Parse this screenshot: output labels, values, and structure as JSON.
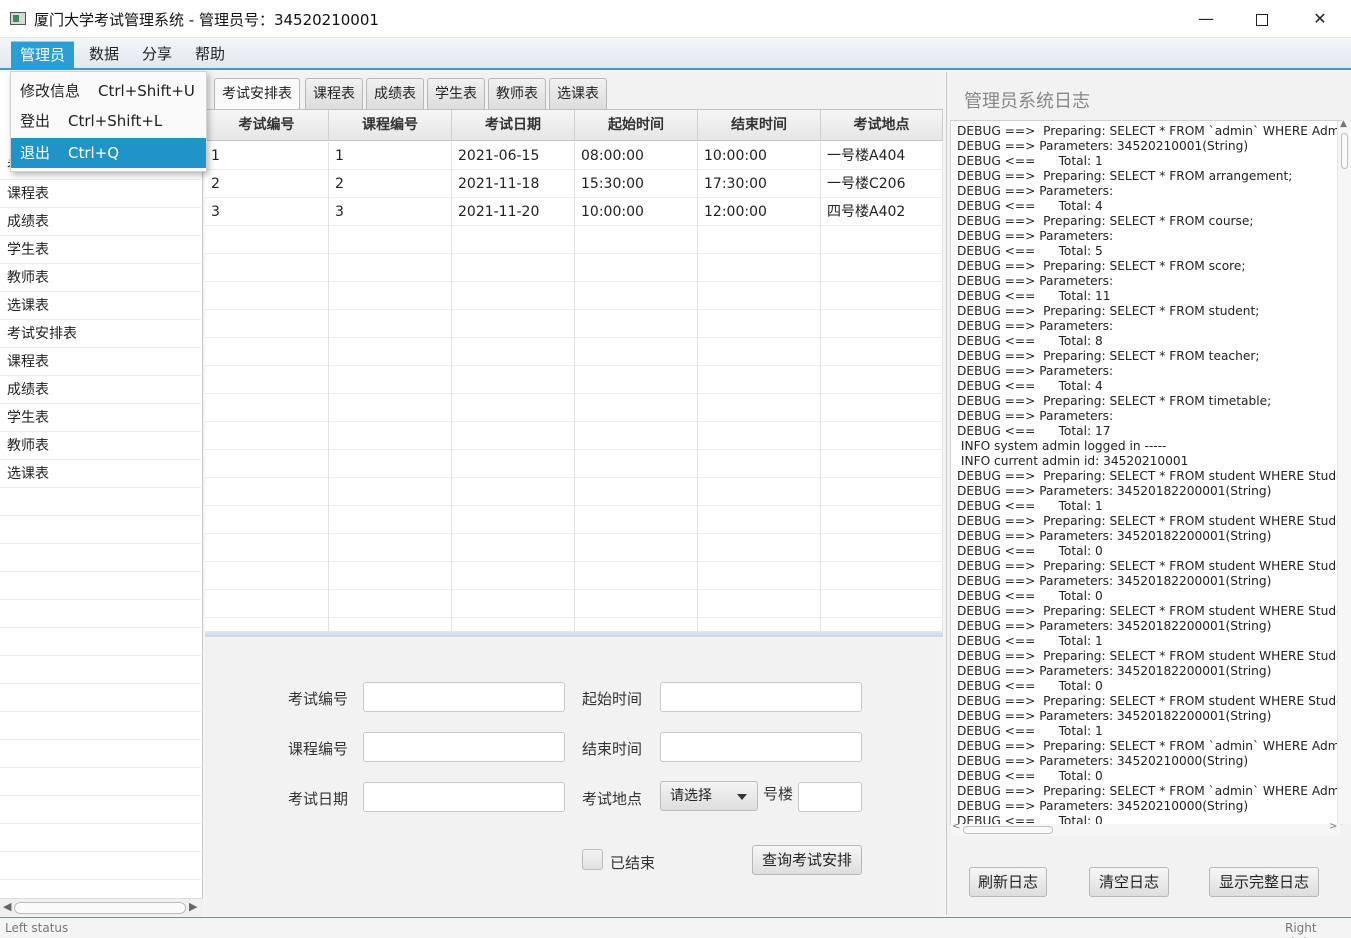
{
  "window": {
    "title": "厦门大学考试管理系统 - 管理员号：34520210001",
    "minimize_glyph": "—",
    "close_glyph": "✕"
  },
  "menubar": [
    "管理员",
    "数据",
    "分享",
    "帮助"
  ],
  "dropdown": [
    {
      "label": "修改信息",
      "shortcut": "Ctrl+Shift+U"
    },
    {
      "label": "登出",
      "shortcut": "Ctrl+Shift+L"
    },
    {
      "label": "退出",
      "shortcut": "Ctrl+Q"
    }
  ],
  "left_list": [
    "考试安排表",
    "课程表",
    "成绩表",
    "学生表",
    "教师表",
    "选课表",
    "考试安排表",
    "课程表",
    "成绩表",
    "学生表",
    "教师表",
    "选课表"
  ],
  "tabs": [
    "考试安排表",
    "课程表",
    "成绩表",
    "学生表",
    "教师表",
    "选课表"
  ],
  "table": {
    "columns": [
      "考试编号",
      "课程编号",
      "考试日期",
      "起始时间",
      "结束时间",
      "考试地点"
    ],
    "rows": [
      [
        "1",
        "1",
        "2021-06-15",
        "08:00:00",
        "10:00:00",
        "一号楼A404"
      ],
      [
        "2",
        "2",
        "2021-11-18",
        "15:30:00",
        "17:30:00",
        "一号楼C206"
      ],
      [
        "3",
        "3",
        "2021-11-20",
        "10:00:00",
        "12:00:00",
        "四号楼A402"
      ]
    ]
  },
  "form": {
    "exam_id_label": "考试编号",
    "course_id_label": "课程编号",
    "exam_date_label": "考试日期",
    "start_time_label": "起始时间",
    "end_time_label": "结束时间",
    "location_label": "考试地点",
    "location_select": "请选择",
    "building_suffix": "号楼",
    "finished_label": "已结束",
    "query_button": "查询考试安排"
  },
  "log": {
    "title": "管理员系统日志",
    "lines": [
      "DEBUG ==>  Preparing: SELECT * FROM `admin` WHERE AdminId",
      "DEBUG ==> Parameters: 34520210001(String)",
      "DEBUG <==      Total: 1",
      "DEBUG ==>  Preparing: SELECT * FROM arrangement;",
      "DEBUG ==> Parameters: ",
      "DEBUG <==      Total: 4",
      "DEBUG ==>  Preparing: SELECT * FROM course;",
      "DEBUG ==> Parameters: ",
      "DEBUG <==      Total: 5",
      "DEBUG ==>  Preparing: SELECT * FROM score;",
      "DEBUG ==> Parameters: ",
      "DEBUG <==      Total: 11",
      "DEBUG ==>  Preparing: SELECT * FROM student;",
      "DEBUG ==> Parameters: ",
      "DEBUG <==      Total: 8",
      "DEBUG ==>  Preparing: SELECT * FROM teacher;",
      "DEBUG ==> Parameters: ",
      "DEBUG <==      Total: 4",
      "DEBUG ==>  Preparing: SELECT * FROM timetable;",
      "DEBUG ==> Parameters: ",
      "DEBUG <==      Total: 17",
      " INFO system admin logged in -----",
      " INFO current admin id: 34520210001",
      "DEBUG ==>  Preparing: SELECT * FROM student WHERE StudentId",
      "DEBUG ==> Parameters: 34520182200001(String)",
      "DEBUG <==      Total: 1",
      "DEBUG ==>  Preparing: SELECT * FROM student WHERE StudentId",
      "DEBUG ==> Parameters: 34520182200001(String)",
      "DEBUG <==      Total: 0",
      "DEBUG ==>  Preparing: SELECT * FROM student WHERE StudentId",
      "DEBUG ==> Parameters: 34520182200001(String)",
      "DEBUG <==      Total: 0",
      "DEBUG ==>  Preparing: SELECT * FROM student WHERE StudentId",
      "DEBUG ==> Parameters: 34520182200001(String)",
      "DEBUG <==      Total: 1",
      "DEBUG ==>  Preparing: SELECT * FROM student WHERE StudentId",
      "DEBUG ==> Parameters: 34520182200001(String)",
      "DEBUG <==      Total: 0",
      "DEBUG ==>  Preparing: SELECT * FROM student WHERE StudentId",
      "DEBUG ==> Parameters: 34520182200001(String)",
      "DEBUG <==      Total: 1",
      "DEBUG ==>  Preparing: SELECT * FROM `admin` WHERE AdminId",
      "DEBUG ==> Parameters: 34520210000(String)",
      "DEBUG <==      Total: 0",
      "DEBUG ==>  Preparing: SELECT * FROM `admin` WHERE AdminId",
      "DEBUG ==> Parameters: 34520210000(String)",
      "DEBUG <==      Total: 0"
    ],
    "refresh_button": "刷新日志",
    "clear_button": "清空日志",
    "full_button": "显示完整日志"
  },
  "status": {
    "left": "Left status",
    "right": "Right status"
  },
  "colors": {
    "accent": "#2a9fd6",
    "menu_highlight": "#1f94c9"
  }
}
